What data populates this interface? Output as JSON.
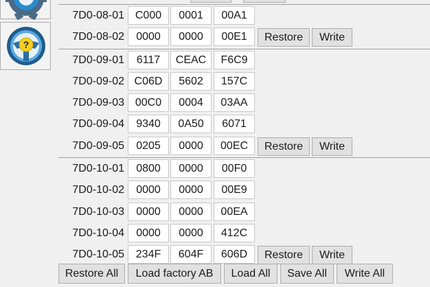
{
  "sidebar": {
    "icons": [
      "gear-icon",
      "help-steering-icon"
    ],
    "help_glyph": "?"
  },
  "groups": [
    {
      "rows": [
        {
          "addr": "7D0-08-01",
          "values": [
            "C000",
            "0001",
            "00A1"
          ]
        },
        {
          "addr": "7D0-08-02",
          "values": [
            "0000",
            "0000",
            "00E1"
          ],
          "actions": true
        }
      ]
    },
    {
      "rows": [
        {
          "addr": "7D0-09-01",
          "values": [
            "6117",
            "CEAC",
            "F6C9"
          ]
        },
        {
          "addr": "7D0-09-02",
          "values": [
            "C06D",
            "5602",
            "157C"
          ]
        },
        {
          "addr": "7D0-09-03",
          "values": [
            "00C0",
            "0004",
            "03AA"
          ]
        },
        {
          "addr": "7D0-09-04",
          "values": [
            "9340",
            "0A50",
            "6071"
          ]
        },
        {
          "addr": "7D0-09-05",
          "values": [
            "0205",
            "0000",
            "00EC"
          ],
          "actions": true
        }
      ]
    },
    {
      "rows": [
        {
          "addr": "7D0-10-01",
          "values": [
            "0800",
            "0000",
            "00F0"
          ]
        },
        {
          "addr": "7D0-10-02",
          "values": [
            "0000",
            "0000",
            "00E9"
          ]
        },
        {
          "addr": "7D0-10-03",
          "values": [
            "0000",
            "0000",
            "00EA"
          ]
        },
        {
          "addr": "7D0-10-04",
          "values": [
            "0000",
            "0000",
            "412C"
          ]
        },
        {
          "addr": "7D0-10-05",
          "values": [
            "234F",
            "604F",
            "606D"
          ],
          "actions": true
        }
      ]
    }
  ],
  "row_actions": {
    "restore": "Restore",
    "write": "Write"
  },
  "footer": {
    "restore_all": "Restore All",
    "load_factory_ab": "Load factory AB",
    "load_all": "Load All",
    "save_all": "Save All",
    "write_all": "Write All"
  }
}
